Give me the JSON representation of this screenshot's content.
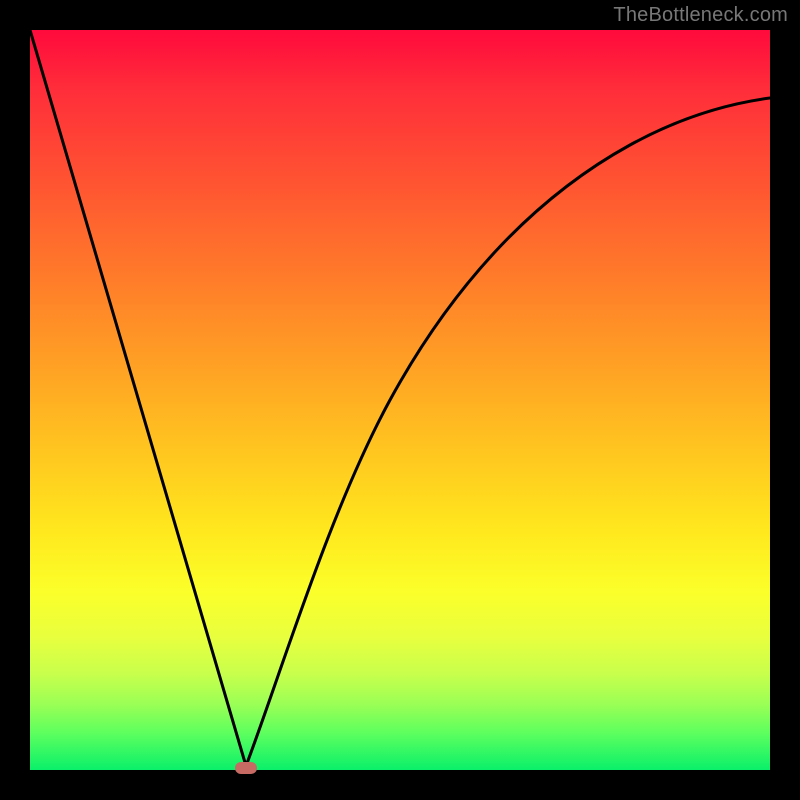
{
  "watermark": "TheBottleneck.com",
  "chart_data": {
    "type": "line",
    "title": "",
    "xlabel": "",
    "ylabel": "",
    "xlim": [
      0,
      100
    ],
    "ylim": [
      0,
      100
    ],
    "series": [
      {
        "name": "bottleneck-curve",
        "x": [
          0,
          5,
          10,
          15,
          20,
          25,
          28,
          30,
          32,
          35,
          40,
          45,
          50,
          55,
          60,
          65,
          70,
          75,
          80,
          85,
          90,
          95,
          100
        ],
        "y": [
          100,
          82,
          64,
          47,
          29,
          11,
          2,
          0,
          3,
          12,
          27,
          40,
          50,
          58,
          65,
          71,
          75,
          79,
          82,
          84,
          86,
          87,
          88
        ]
      }
    ],
    "minimum": {
      "x": 30,
      "y": 0
    },
    "gradient_colors": {
      "top": "#ff0a3c",
      "mid": "#ffe91e",
      "bottom": "#0af06a"
    }
  }
}
